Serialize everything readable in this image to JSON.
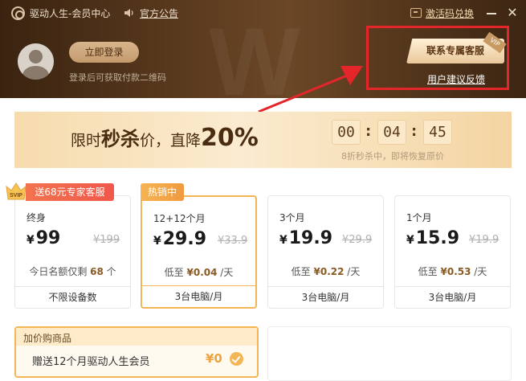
{
  "titlebar": {
    "app_title": "驱动人生-会员中心",
    "notice": "官方公告",
    "redeem": "激活码兑换",
    "close_glyph": "✕"
  },
  "header": {
    "login_button": "立即登录",
    "login_hint": "登录后可获取付款二维码",
    "service_button": "联系专属客服",
    "vip_tag": "VIP",
    "feedback": "用户建议反馈"
  },
  "banner": {
    "title_pre": "限时",
    "title_big": "秒杀",
    "title_mid": "价，直降",
    "title_pct": "20%",
    "countdown": [
      "00",
      "04",
      "45"
    ],
    "subtitle": "8折秒杀中，即将恢复原价"
  },
  "badges": {
    "svip": "SVIP",
    "gift": "送68元专家客服",
    "hot": "热销中"
  },
  "plans": [
    {
      "name": "终身",
      "currency": "¥",
      "price": "99",
      "old_price": "¥199",
      "daily_pre": "今日名额仅剩 ",
      "daily_val": "68",
      "daily_post": " 个",
      "footer": "不限设备数"
    },
    {
      "name": "12+12个月",
      "currency": "¥",
      "price": "29.9",
      "old_price": "¥33.9",
      "daily_pre": "低至 ",
      "daily_val": "¥0.04",
      "daily_post": " /天",
      "footer": "3台电脑/月"
    },
    {
      "name": "3个月",
      "currency": "¥",
      "price": "19.9",
      "old_price": "¥29.9",
      "daily_pre": "低至 ",
      "daily_val": "¥0.22",
      "daily_post": " /天",
      "footer": "3台电脑/月"
    },
    {
      "name": "1个月",
      "currency": "¥",
      "price": "15.9",
      "old_price": "¥19.9",
      "daily_pre": "低至 ",
      "daily_val": "¥0.53",
      "daily_post": " /天",
      "footer": "3台电脑/月"
    }
  ],
  "addon": {
    "title": "加价购商品",
    "item": "赠送12个月驱动人生会员",
    "price": "¥0"
  },
  "colors": {
    "accent_gold": "#f2b656",
    "annotation_red": "#e4262b",
    "header_brown": "#5a3a1e"
  }
}
